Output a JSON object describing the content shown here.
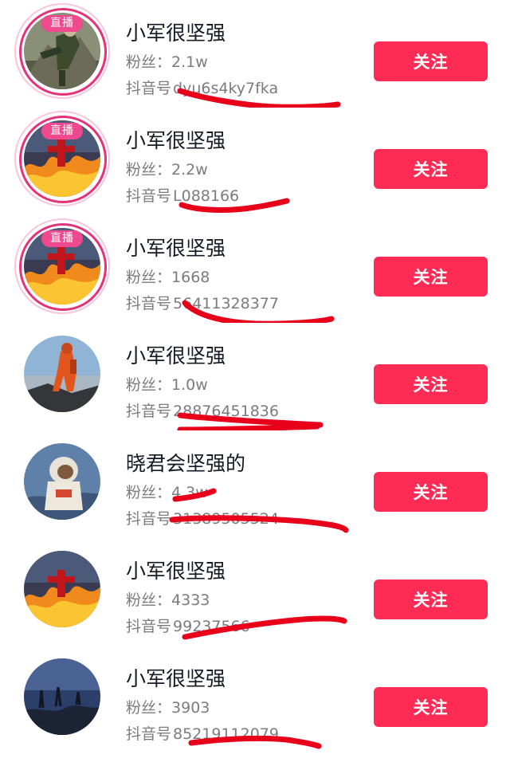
{
  "users": [
    {
      "name": "小军很坚强",
      "fans_label": "粉丝：",
      "fans": "2.1w",
      "id_label": "抖音号",
      "id_visible": "dyu6s4ky7fka",
      "live": true,
      "live_label": "直播",
      "follow_label": "关注",
      "avatar_icon": "firefighter-on-rocks"
    },
    {
      "name": "小军很坚强",
      "fans_label": "粉丝：",
      "fans": "2.2w",
      "id_label": "抖音号",
      "id_visible": "L088166",
      "live": true,
      "live_label": "直播",
      "follow_label": "关注",
      "avatar_icon": "firefighter-flames"
    },
    {
      "name": "小军很坚强",
      "fans_label": "粉丝：",
      "fans": "1668",
      "id_label": "抖音号",
      "id_visible": "56411328377",
      "live": true,
      "live_label": "直播",
      "follow_label": "关注",
      "avatar_icon": "firefighter-flames"
    },
    {
      "name": "小军很坚强",
      "fans_label": "粉丝：",
      "fans": "1.0w",
      "id_label": "抖音号",
      "id_visible": "28876451836",
      "live": false,
      "live_label": "",
      "follow_label": "关注",
      "avatar_icon": "firefighter-orange-suit"
    },
    {
      "name": "晓君会坚强的",
      "fans_label": "粉丝：",
      "fans": "4.3w",
      "id_label": "抖音号",
      "id_visible": "31389505524",
      "live": false,
      "live_label": "",
      "follow_label": "关注",
      "avatar_icon": "astronaut"
    },
    {
      "name": "小军很坚强",
      "fans_label": "粉丝：",
      "fans": "4333",
      "id_label": "抖音号",
      "id_visible": "99237566",
      "live": false,
      "live_label": "",
      "follow_label": "关注",
      "avatar_icon": "firefighter-flames"
    },
    {
      "name": "小军很坚强",
      "fans_label": "粉丝：",
      "fans": "3903",
      "id_label": "抖音号",
      "id_visible": "85219112079",
      "live": false,
      "live_label": "",
      "follow_label": "关注",
      "avatar_icon": "night-landscape"
    }
  ],
  "colors": {
    "follow_button": "#fe2c55",
    "live_ring": "#e4337a",
    "live_badge": "#ef4a8d",
    "secondary_text": "#7b7b80",
    "scribble": "#e8001a"
  }
}
